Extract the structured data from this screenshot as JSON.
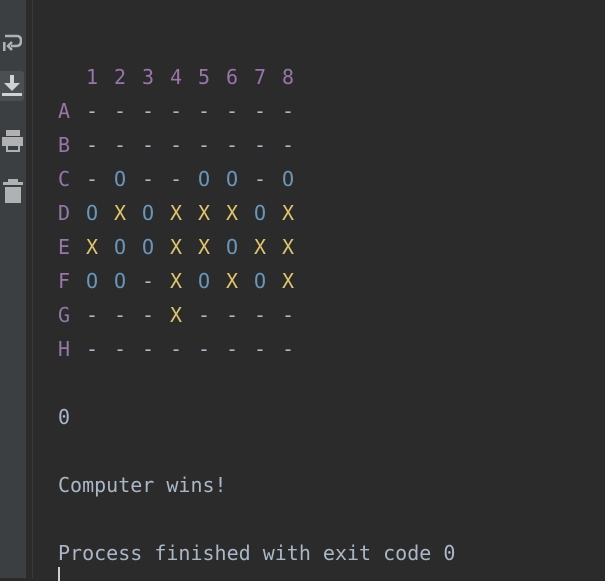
{
  "toolbar": {
    "items": [
      {
        "icon": "soft-wrap-icon"
      },
      {
        "icon": "scroll-to-end-icon",
        "active": true
      },
      {
        "icon": "print-icon"
      },
      {
        "icon": "trash-icon"
      }
    ]
  },
  "colors": {
    "background": "#2b2b2b",
    "label": "#9876aa",
    "dash": "#a9b7c6",
    "o": "#6897bb",
    "x": "#e0c46c",
    "text": "#a9b7c6"
  },
  "board": {
    "column_labels": [
      "1",
      "2",
      "3",
      "4",
      "5",
      "6",
      "7",
      "8"
    ],
    "row_labels": [
      "A",
      "B",
      "C",
      "D",
      "E",
      "F",
      "G",
      "H"
    ],
    "rows": [
      [
        "-",
        "-",
        "-",
        "-",
        "-",
        "-",
        "-",
        "-"
      ],
      [
        "-",
        "-",
        "-",
        "-",
        "-",
        "-",
        "-",
        "-"
      ],
      [
        "-",
        "O",
        "-",
        "-",
        "O",
        "O",
        "-",
        "O"
      ],
      [
        "O",
        "X",
        "O",
        "X",
        "X",
        "X",
        "O",
        "X"
      ],
      [
        "X",
        "O",
        "O",
        "X",
        "X",
        "O",
        "X",
        "X"
      ],
      [
        "O",
        "O",
        "-",
        "X",
        "O",
        "X",
        "O",
        "X"
      ],
      [
        "-",
        "-",
        "-",
        "X",
        "-",
        "-",
        "-",
        "-"
      ],
      [
        "-",
        "-",
        "-",
        "-",
        "-",
        "-",
        "-",
        "-"
      ]
    ]
  },
  "output": {
    "score": "0",
    "result": "Computer wins!",
    "exit_message": "Process finished with exit code 0"
  }
}
